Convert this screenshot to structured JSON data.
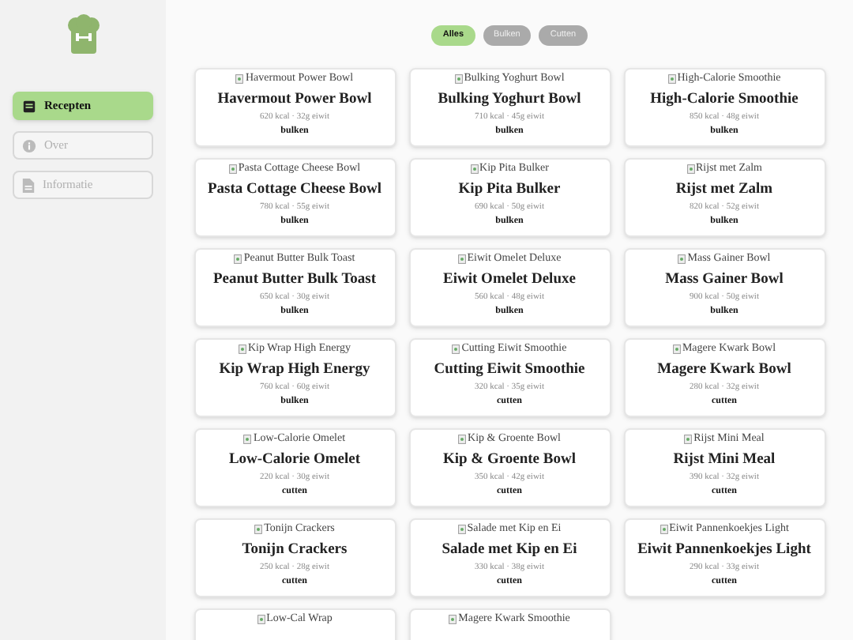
{
  "sidebar": {
    "items": [
      {
        "label": "Recepten",
        "kind": "book",
        "selected": true
      },
      {
        "label": "Over",
        "kind": "info",
        "selected": false
      },
      {
        "label": "Informatie",
        "kind": "file",
        "selected": false
      }
    ]
  },
  "filters": [
    {
      "label": "Alles",
      "selected": true
    },
    {
      "label": "Bulken",
      "selected": false
    },
    {
      "label": "Cutten",
      "selected": false
    }
  ],
  "recipes": [
    {
      "image_alt": "Havermout Power Bowl",
      "title": "Havermout Power Bowl",
      "stats": "620 kcal · 32g eiwit",
      "tag": "bulken"
    },
    {
      "image_alt": "Bulking Yoghurt Bowl",
      "title": "Bulking Yoghurt Bowl",
      "stats": "710 kcal · 45g eiwit",
      "tag": "bulken"
    },
    {
      "image_alt": "High-Calorie Smoothie",
      "title": "High-Calorie Smoothie",
      "stats": "850 kcal · 48g eiwit",
      "tag": "bulken"
    },
    {
      "image_alt": "Pasta Cottage Cheese Bowl",
      "title": "Pasta Cottage Cheese Bowl",
      "stats": "780 kcal · 55g eiwit",
      "tag": "bulken"
    },
    {
      "image_alt": "Kip Pita Bulker",
      "title": "Kip Pita Bulker",
      "stats": "690 kcal · 50g eiwit",
      "tag": "bulken"
    },
    {
      "image_alt": "Rijst met Zalm",
      "title": "Rijst met Zalm",
      "stats": "820 kcal · 52g eiwit",
      "tag": "bulken"
    },
    {
      "image_alt": "Peanut Butter Bulk Toast",
      "title": "Peanut Butter Bulk Toast",
      "stats": "650 kcal · 30g eiwit",
      "tag": "bulken"
    },
    {
      "image_alt": "Eiwit Omelet Deluxe",
      "title": "Eiwit Omelet Deluxe",
      "stats": "560 kcal · 48g eiwit",
      "tag": "bulken"
    },
    {
      "image_alt": "Mass Gainer Bowl",
      "title": "Mass Gainer Bowl",
      "stats": "900 kcal · 50g eiwit",
      "tag": "bulken"
    },
    {
      "image_alt": "Kip Wrap High Energy",
      "title": "Kip Wrap High Energy",
      "stats": "760 kcal · 60g eiwit",
      "tag": "bulken"
    },
    {
      "image_alt": "Cutting Eiwit Smoothie",
      "title": "Cutting Eiwit Smoothie",
      "stats": "320 kcal · 35g eiwit",
      "tag": "cutten"
    },
    {
      "image_alt": "Magere Kwark Bowl",
      "title": "Magere Kwark Bowl",
      "stats": "280 kcal · 32g eiwit",
      "tag": "cutten"
    },
    {
      "image_alt": "Low-Calorie Omelet",
      "title": "Low-Calorie Omelet",
      "stats": "220 kcal · 30g eiwit",
      "tag": "cutten"
    },
    {
      "image_alt": "Kip & Groente Bowl",
      "title": "Kip & Groente Bowl",
      "stats": "350 kcal · 42g eiwit",
      "tag": "cutten"
    },
    {
      "image_alt": "Rijst Mini Meal",
      "title": "Rijst Mini Meal",
      "stats": "390 kcal · 32g eiwit",
      "tag": "cutten"
    },
    {
      "image_alt": "Tonijn Crackers",
      "title": "Tonijn Crackers",
      "stats": "250 kcal · 28g eiwit",
      "tag": "cutten"
    },
    {
      "image_alt": "Salade met Kip en Ei",
      "title": "Salade met Kip en Ei",
      "stats": "330 kcal · 38g eiwit",
      "tag": "cutten"
    },
    {
      "image_alt": "Eiwit Pannenkoekjes Light",
      "title": "Eiwit Pannenkoekjes Light",
      "stats": "290 kcal · 33g eiwit",
      "tag": "cutten"
    },
    {
      "image_alt": "Low-Cal Wrap"
    },
    {
      "image_alt": "Magere Kwark Smoothie"
    }
  ]
}
